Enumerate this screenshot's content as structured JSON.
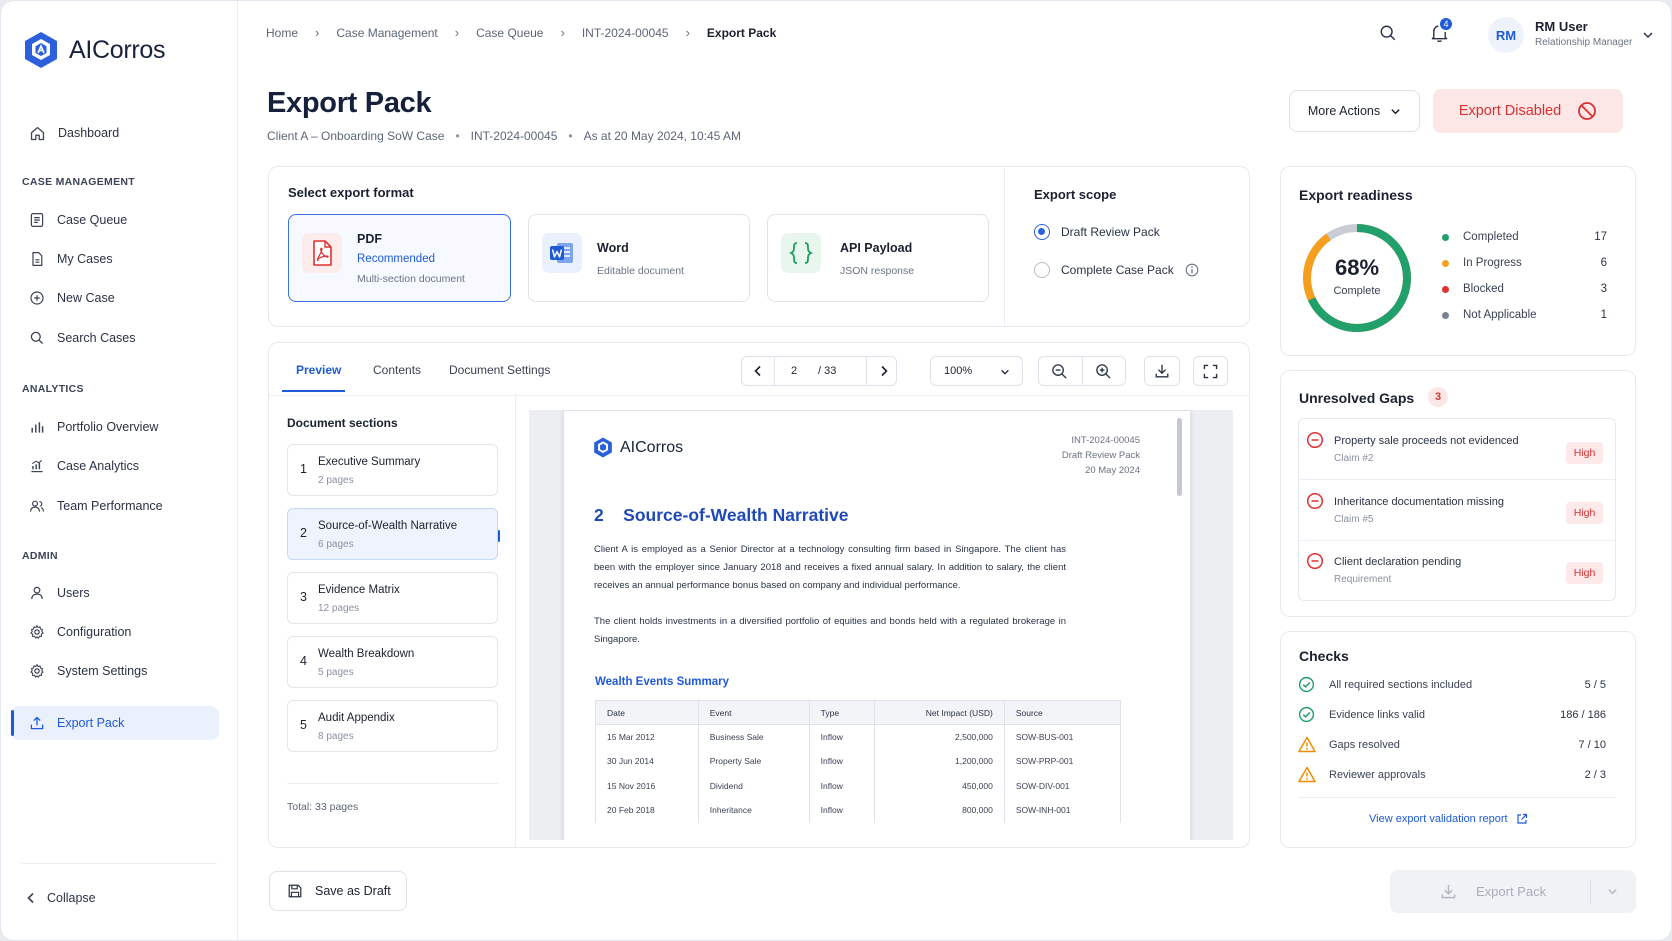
{
  "app": {
    "name": "AICorros"
  },
  "sidebar": {
    "dashboard": "Dashboard",
    "sections": {
      "case_management": "CASE MANAGEMENT",
      "analytics": "ANALYTICS",
      "admin": "ADMIN"
    },
    "case_items": [
      "Case Queue",
      "My Cases",
      "New Case",
      "Search Cases"
    ],
    "analytics_items": [
      "Portfolio Overview",
      "Case Analytics",
      "Team Performance"
    ],
    "admin_items": [
      "Users",
      "Configuration",
      "System Settings"
    ],
    "active_item": "Export Pack",
    "collapse": "Collapse"
  },
  "breadcrumb": [
    "Home",
    "Case Management",
    "Case Queue",
    "INT-2024-00045",
    "Export Pack"
  ],
  "topbar": {
    "notification_count": "4"
  },
  "user": {
    "initials": "RM",
    "name": "RM User",
    "role": "Relationship Manager"
  },
  "page": {
    "title": "Export Pack",
    "client": "Client A – Onboarding SoW Case",
    "case_id": "INT-2024-00045",
    "as_at": "As at 20 May 2024, 10:45 AM",
    "more_actions": "More Actions",
    "export_disabled": "Export Disabled"
  },
  "format": {
    "title": "Select export format",
    "options": [
      {
        "name": "PDF",
        "tag": "Recommended",
        "desc": "Multi-section document",
        "selected": true
      },
      {
        "name": "Word",
        "desc": "Editable document",
        "selected": false
      },
      {
        "name": "API Payload",
        "desc": "JSON response",
        "selected": false
      }
    ]
  },
  "scope": {
    "title": "Export scope",
    "options": [
      {
        "label": "Draft Review Pack",
        "selected": true
      },
      {
        "label": "Complete Case Pack",
        "selected": false
      }
    ]
  },
  "readiness": {
    "title": "Export readiness",
    "percent": "68%",
    "percent_value": 68,
    "label": "Complete",
    "items": [
      {
        "label": "Completed",
        "value": "17",
        "color": "#22a06b"
      },
      {
        "label": "In Progress",
        "value": "6",
        "color": "#f59f1e"
      },
      {
        "label": "Blocked",
        "value": "3",
        "color": "#e03131"
      },
      {
        "label": "Not Applicable",
        "value": "1",
        "color": "#7a8190"
      }
    ],
    "ring_colors": {
      "completed": "#22a06b",
      "in_progress": "#f59f1e",
      "rest": "#c9ccd3"
    }
  },
  "gaps": {
    "title": "Unresolved Gaps",
    "count": "3",
    "items": [
      {
        "title": "Property sale proceeds not evidenced",
        "sub": "Claim #2",
        "severity": "High"
      },
      {
        "title": "Inheritance documentation missing",
        "sub": "Claim #5",
        "severity": "High"
      },
      {
        "title": "Client declaration pending",
        "sub": "Requirement",
        "severity": "High"
      }
    ]
  },
  "checks": {
    "title": "Checks",
    "items": [
      {
        "label": "All required sections included",
        "value": "5 / 5",
        "status": "ok"
      },
      {
        "label": "Evidence links valid",
        "value": "186 / 186",
        "status": "ok"
      },
      {
        "label": "Gaps resolved",
        "value": "7 / 10",
        "status": "warn"
      },
      {
        "label": "Reviewer approvals",
        "value": "2 / 3",
        "status": "warn"
      }
    ],
    "link": "View export validation report"
  },
  "preview": {
    "tabs": [
      "Preview",
      "Contents",
      "Document Settings"
    ],
    "page_current": "2",
    "page_total": "/ 33",
    "zoom": "100%",
    "sections_title": "Document sections",
    "sections": [
      {
        "num": "1",
        "name": "Executive Summary",
        "pages": "2 pages"
      },
      {
        "num": "2",
        "name": "Source-of-Wealth Narrative",
        "pages": "6 pages"
      },
      {
        "num": "3",
        "name": "Evidence Matrix",
        "pages": "12 pages"
      },
      {
        "num": "4",
        "name": "Wealth Breakdown",
        "pages": "5 pages"
      },
      {
        "num": "5",
        "name": "Audit Appendix",
        "pages": "8 pages"
      }
    ],
    "total": "Total: 33 pages"
  },
  "doc": {
    "brand": "AICorros",
    "meta": [
      "INT-2024-00045",
      "Draft Review Pack",
      "20 May 2024"
    ],
    "heading": "2    Source-of-Wealth Narrative",
    "para1": "Client A is employed as a Senior Director at a technology consulting firm based in Singapore. The client has been with the employer since January 2018 and receives a fixed annual salary. In addition to salary, the client receives an annual performance bonus based on company and individual performance.",
    "para2": "The client holds investments in a diversified portfolio of equities and bonds held with a regulated brokerage in Singapore.",
    "subheading": "Wealth Events Summary",
    "table": {
      "headers": [
        "Date",
        "Event",
        "Type",
        "Net Impact (USD)",
        "Source"
      ],
      "rows": [
        [
          "15 Mar 2012",
          "Business Sale",
          "Inflow",
          "2,500,000",
          "SOW-BUS-001"
        ],
        [
          "30 Jun 2014",
          "Property Sale",
          "Inflow",
          "1,200,000",
          "SOW-PRP-001"
        ],
        [
          "15 Nov 2016",
          "Dividend",
          "Inflow",
          "450,000",
          "SOW-DIV-001"
        ],
        [
          "20 Feb 2018",
          "Inheritance",
          "Inflow",
          "800,000",
          "SOW-INH-001"
        ]
      ]
    }
  },
  "footer": {
    "save_draft": "Save as Draft",
    "export_pack": "Export Pack"
  }
}
